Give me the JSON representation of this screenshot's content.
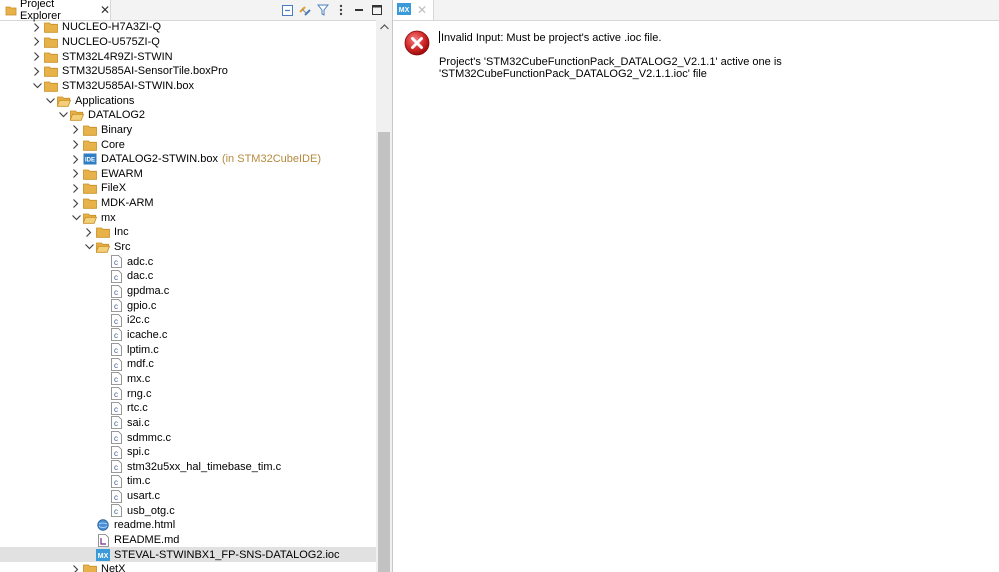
{
  "explorer": {
    "tab_label": "Project Explorer",
    "close_glyph": "✕",
    "toolbar_icons": [
      "collapse-all-icon",
      "link-with-editor-icon",
      "filter-icon",
      "view-menu-icon",
      "minimize-icon",
      "maximize-icon"
    ],
    "tree": [
      {
        "label": "NUCLEO-H7A3ZI-Q",
        "depth": 2,
        "icon": "project-folder",
        "state": "collapsed"
      },
      {
        "label": "NUCLEO-U575ZI-Q",
        "depth": 2,
        "icon": "project-folder",
        "state": "collapsed"
      },
      {
        "label": "STM32L4R9ZI-STWIN",
        "depth": 2,
        "icon": "project-folder",
        "state": "collapsed"
      },
      {
        "label": "STM32U585AI-SensorTile.boxPro",
        "depth": 2,
        "icon": "project-folder",
        "state": "collapsed"
      },
      {
        "label": "STM32U585AI-STWIN.box",
        "depth": 2,
        "icon": "project-folder",
        "state": "expanded"
      },
      {
        "label": "Applications",
        "depth": 3,
        "icon": "folder-open",
        "state": "expanded"
      },
      {
        "label": "DATALOG2",
        "depth": 4,
        "icon": "folder-open",
        "state": "expanded"
      },
      {
        "label": "Binary",
        "depth": 5,
        "icon": "folder",
        "state": "collapsed"
      },
      {
        "label": "Core",
        "depth": 5,
        "icon": "folder",
        "state": "collapsed"
      },
      {
        "label": "DATALOG2-STWIN.box",
        "depth": 5,
        "icon": "ide-project",
        "state": "collapsed",
        "decoration": "(in STM32CubeIDE)"
      },
      {
        "label": "EWARM",
        "depth": 5,
        "icon": "folder",
        "state": "collapsed"
      },
      {
        "label": "FileX",
        "depth": 5,
        "icon": "folder",
        "state": "collapsed"
      },
      {
        "label": "MDK-ARM",
        "depth": 5,
        "icon": "folder",
        "state": "collapsed"
      },
      {
        "label": "mx",
        "depth": 5,
        "icon": "folder-open",
        "state": "expanded"
      },
      {
        "label": "Inc",
        "depth": 6,
        "icon": "folder",
        "state": "collapsed"
      },
      {
        "label": "Src",
        "depth": 6,
        "icon": "folder-open",
        "state": "expanded"
      },
      {
        "label": "adc.c",
        "depth": 7,
        "icon": "c-file",
        "state": "leaf"
      },
      {
        "label": "dac.c",
        "depth": 7,
        "icon": "c-file",
        "state": "leaf"
      },
      {
        "label": "gpdma.c",
        "depth": 7,
        "icon": "c-file",
        "state": "leaf"
      },
      {
        "label": "gpio.c",
        "depth": 7,
        "icon": "c-file",
        "state": "leaf"
      },
      {
        "label": "i2c.c",
        "depth": 7,
        "icon": "c-file",
        "state": "leaf"
      },
      {
        "label": "icache.c",
        "depth": 7,
        "icon": "c-file",
        "state": "leaf"
      },
      {
        "label": "lptim.c",
        "depth": 7,
        "icon": "c-file",
        "state": "leaf"
      },
      {
        "label": "mdf.c",
        "depth": 7,
        "icon": "c-file",
        "state": "leaf"
      },
      {
        "label": "mx.c",
        "depth": 7,
        "icon": "c-file",
        "state": "leaf"
      },
      {
        "label": "rng.c",
        "depth": 7,
        "icon": "c-file",
        "state": "leaf"
      },
      {
        "label": "rtc.c",
        "depth": 7,
        "icon": "c-file",
        "state": "leaf"
      },
      {
        "label": "sai.c",
        "depth": 7,
        "icon": "c-file",
        "state": "leaf"
      },
      {
        "label": "sdmmc.c",
        "depth": 7,
        "icon": "c-file",
        "state": "leaf"
      },
      {
        "label": "spi.c",
        "depth": 7,
        "icon": "c-file",
        "state": "leaf"
      },
      {
        "label": "stm32u5xx_hal_timebase_tim.c",
        "depth": 7,
        "icon": "c-file",
        "state": "leaf"
      },
      {
        "label": "tim.c",
        "depth": 7,
        "icon": "c-file",
        "state": "leaf"
      },
      {
        "label": "usart.c",
        "depth": 7,
        "icon": "c-file",
        "state": "leaf"
      },
      {
        "label": "usb_otg.c",
        "depth": 7,
        "icon": "c-file",
        "state": "leaf"
      },
      {
        "label": "readme.html",
        "depth": 6,
        "icon": "html-file",
        "state": "leaf"
      },
      {
        "label": "README.md",
        "depth": 6,
        "icon": "md-file",
        "state": "leaf"
      },
      {
        "label": "STEVAL-STWINBX1_FP-SNS-DATALOG2.ioc",
        "depth": 6,
        "icon": "ioc-file",
        "state": "leaf",
        "selected": true
      },
      {
        "label": "NetX",
        "depth": 5,
        "icon": "folder",
        "state": "collapsed"
      }
    ]
  },
  "editor": {
    "tab_icon": "MX",
    "close_glyph": "✕",
    "error_title": "Invalid Input: Must be project's active .ioc file.",
    "error_detail": "Project's 'STM32CubeFunctionPack_DATALOG2_V2.1.1' active one is 'STM32CubeFunctionPack_DATALOG2_V2.1.1.ioc' file"
  },
  "colors": {
    "folder": "#e8b24a",
    "folder_dark": "#c98e22",
    "error_red": "#c8102e",
    "mx_blue": "#3b9ad9",
    "selection": "#e1e1e1"
  }
}
